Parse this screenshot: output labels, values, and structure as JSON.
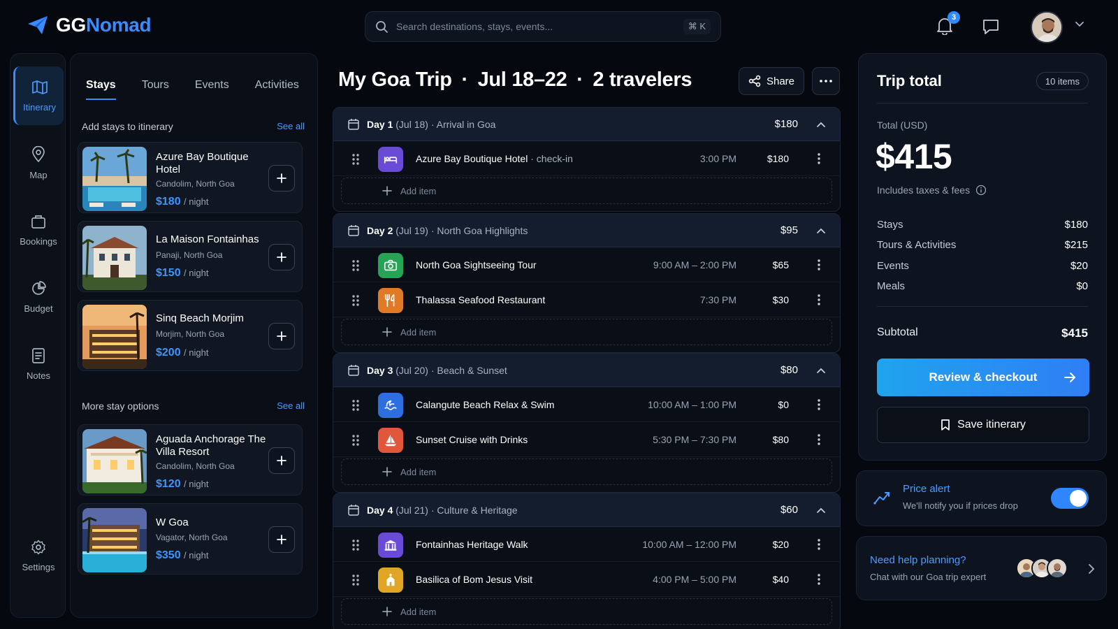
{
  "app": {
    "logo_part1": "GG",
    "logo_part2": "Nomad"
  },
  "search": {
    "placeholder": "Search destinations, stays, events...",
    "shortcut": "⌘ K"
  },
  "header": {
    "notification_count": "3"
  },
  "rail": {
    "items": [
      {
        "label": "Itinerary",
        "icon": "map-icon",
        "active": true
      },
      {
        "label": "Map",
        "icon": "pin-icon"
      },
      {
        "label": "Bookings",
        "icon": "briefcase-icon"
      },
      {
        "label": "Budget",
        "icon": "pie-chart-icon"
      },
      {
        "label": "Notes",
        "icon": "notes-icon"
      }
    ],
    "settings_label": "Settings"
  },
  "stays_panel": {
    "tabs": [
      "Stays",
      "Tours",
      "Events",
      "Activities"
    ],
    "add_section_title": "Add stays to itinerary",
    "more_section_title": "More stay options",
    "see_all": "See all",
    "per_night": "/ night",
    "stays": [
      {
        "name": "Azure Bay Boutique Hotel",
        "location": "Candolim, North Goa",
        "price": "$180"
      },
      {
        "name": "La Maison Fontainhas",
        "location": "Panaji, North Goa",
        "price": "$150"
      },
      {
        "name": "Sinq Beach Morjim",
        "location": "Morjim, North Goa",
        "price": "$200"
      }
    ],
    "more_stays": [
      {
        "name": "Aguada Anchorage The Villa Resort",
        "location": "Candolim, North Goa",
        "price": "$120"
      },
      {
        "name": "W Goa",
        "location": "Vagator, North Goa",
        "price": "$350"
      }
    ]
  },
  "trip": {
    "title": "My Goa Trip",
    "dates": "Jul 18–22",
    "travelers": "2 travelers",
    "separator": "·",
    "share_label": "Share",
    "add_item_label": "Add item",
    "days": [
      {
        "label": "Day 1",
        "date": "(Jul 18)",
        "theme": "Arrival in Goa",
        "total": "$180",
        "items": [
          {
            "name": "Azure Bay Boutique Hotel",
            "sub": "check-in",
            "time": "3:00 PM",
            "price": "$180",
            "icon": "bed-icon",
            "color": "#6a4bd8"
          }
        ]
      },
      {
        "label": "Day 2",
        "date": "(Jul 19)",
        "theme": "North Goa Highlights",
        "total": "$95",
        "items": [
          {
            "name": "North Goa Sightseeing Tour",
            "time": "9:00 AM – 2:00 PM",
            "price": "$65",
            "icon": "camera-icon",
            "color": "#27a355"
          },
          {
            "name": "Thalassa Seafood Restaurant",
            "time": "7:30 PM",
            "price": "$30",
            "icon": "utensils-icon",
            "color": "#e07a27"
          }
        ]
      },
      {
        "label": "Day 3",
        "date": "(Jul 20)",
        "theme": "Beach & Sunset",
        "total": "$80",
        "items": [
          {
            "name": "Calangute Beach Relax & Swim",
            "time": "10:00 AM – 1:00 PM",
            "price": "$0",
            "icon": "wave-icon",
            "color": "#2d6fe0"
          },
          {
            "name": "Sunset Cruise with Drinks",
            "time": "5:30 PM – 7:30 PM",
            "price": "$80",
            "icon": "sailboat-icon",
            "color": "#e0573a"
          }
        ]
      },
      {
        "label": "Day 4",
        "date": "(Jul 21)",
        "theme": "Culture & Heritage",
        "total": "$60",
        "items": [
          {
            "name": "Fontainhas Heritage Walk",
            "time": "10:00 AM – 12:00 PM",
            "price": "$20",
            "icon": "museum-icon",
            "color": "#6a4bd8"
          },
          {
            "name": "Basilica of Bom Jesus Visit",
            "time": "4:00 PM – 5:00 PM",
            "price": "$40",
            "icon": "church-icon",
            "color": "#e0a524"
          }
        ]
      }
    ]
  },
  "total_card": {
    "title": "Trip total",
    "badge": "10 items",
    "total_label": "Total (USD)",
    "total": "$415",
    "note": "Includes taxes & fees",
    "lines": [
      {
        "label": "Stays",
        "value": "$180"
      },
      {
        "label": "Tours & Activities",
        "value": "$215"
      },
      {
        "label": "Events",
        "value": "$20"
      },
      {
        "label": "Meals",
        "value": "$0"
      }
    ],
    "subtotal_label": "Subtotal",
    "subtotal": "$415",
    "checkout_label": "Review & checkout",
    "save_label": "Save itinerary"
  },
  "price_alert": {
    "title": "Price alert",
    "subtitle": "We'll notify you if prices drop",
    "enabled": true
  },
  "help": {
    "title": "Need help planning?",
    "subtitle": "Chat with our Goa trip expert"
  },
  "colors": {
    "accent": "#3b8bff",
    "checkout_gradient_start": "#1fa4ee",
    "checkout_gradient_end": "#2f7ef5"
  }
}
